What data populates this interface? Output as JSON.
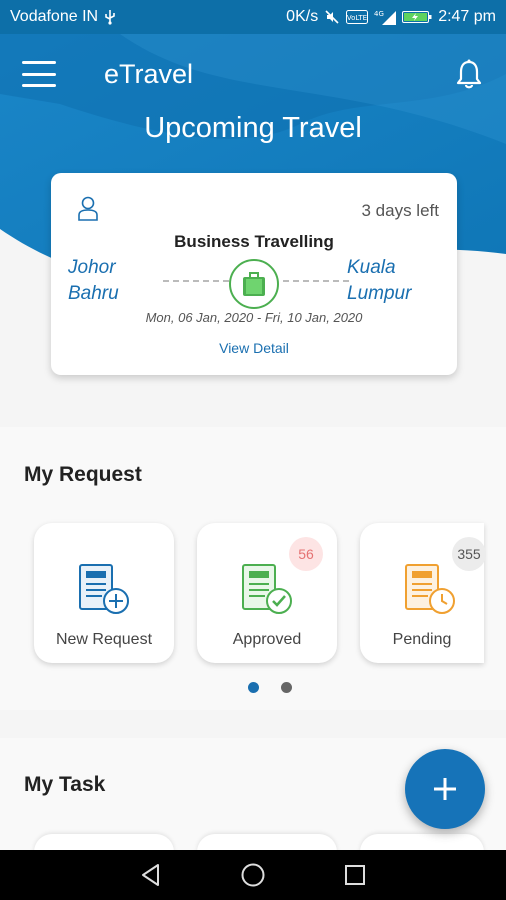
{
  "status_bar": {
    "carrier": "Vodafone IN",
    "net_speed": "0K/s",
    "volte": "VoLTE",
    "network": "4G",
    "time": "2:47 pm"
  },
  "app_bar": {
    "title": "eTravel",
    "menu_icon": "hamburger-menu-icon",
    "notification_icon": "bell-icon"
  },
  "page_title": "Upcoming Travel",
  "travel_card": {
    "days_left": "3 days left",
    "title": "Business Travelling",
    "from_line1": "Johor",
    "from_line2": "Bahru",
    "to_line1": "Kuala",
    "to_line2": "Lumpur",
    "dates": "Mon, 06 Jan, 2020 - Fri, 10 Jan, 2020",
    "view_detail": "View Detail",
    "accent": "#4caf50"
  },
  "my_request": {
    "title": "My Request",
    "cards": [
      {
        "label": "New Request",
        "badge": "",
        "color": "#1a6fb0"
      },
      {
        "label": "Approved",
        "badge": "56",
        "color": "#4caf50"
      },
      {
        "label": "Pending",
        "badge": "355",
        "color": "#f0a030"
      }
    ],
    "page_count": 2,
    "active_page": 0
  },
  "my_task": {
    "title": "My Task"
  },
  "fab_icon": "plus-icon",
  "nav": [
    "back-icon",
    "home-icon",
    "recents-icon"
  ],
  "colors": {
    "primary": "#1673b8",
    "header_dark": "#0d6fa8",
    "header_light": "#2a93d1"
  }
}
